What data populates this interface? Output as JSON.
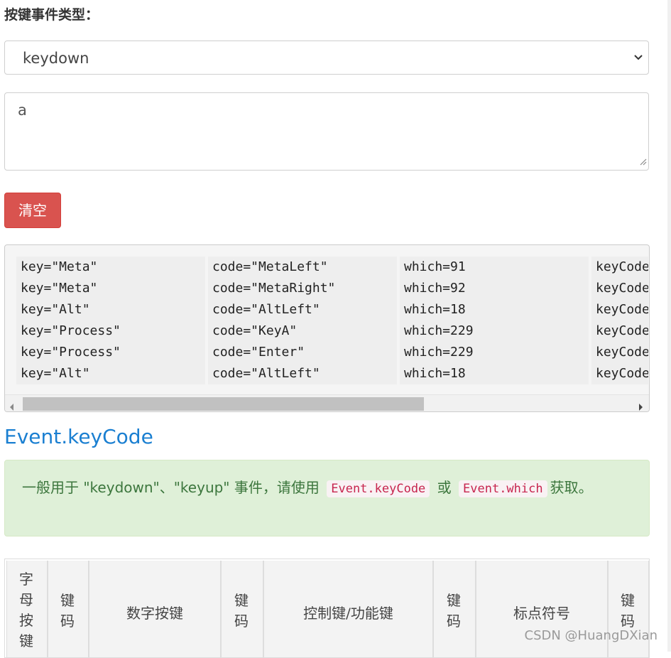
{
  "form": {
    "event_type_label": "按键事件类型：",
    "event_type_value": "keydown",
    "input_value": "a",
    "clear_button": "清空"
  },
  "log": {
    "rows": [
      {
        "key": "key=\"Meta\"",
        "code": "code=\"MetaLeft\"",
        "which": "which=91",
        "keycode": "keyCode"
      },
      {
        "key": "key=\"Meta\"",
        "code": "code=\"MetaRight\"",
        "which": "which=92",
        "keycode": "keyCode"
      },
      {
        "key": "key=\"Alt\"",
        "code": "code=\"AltLeft\"",
        "which": "which=18",
        "keycode": "keyCode"
      },
      {
        "key": "key=\"Process\"",
        "code": "code=\"KeyA\"",
        "which": "which=229",
        "keycode": "keyCode"
      },
      {
        "key": "key=\"Process\"",
        "code": "code=\"Enter\"",
        "which": "which=229",
        "keycode": "keyCode"
      },
      {
        "key": "key=\"Alt\"",
        "code": "code=\"AltLeft\"",
        "which": "which=18",
        "keycode": "keyCode"
      }
    ]
  },
  "section": {
    "title": "Event.keyCode",
    "alert_prefix": "一般用于 \"keydown\"、\"keyup\" 事件，请使用",
    "code1": "Event.keyCode",
    "alert_mid": "或",
    "code2": "Event.which",
    "alert_suffix": "获取。"
  },
  "table": {
    "headers": [
      "字母按键",
      "键码",
      "数字按键",
      "键码",
      "控制键/功能键",
      "键码",
      "标点符号",
      "键码"
    ]
  },
  "watermark": "CSDN @HuangDXian",
  "colors": {
    "danger": "#d9534f",
    "link_blue": "#1a7fd1",
    "success_bg": "#dff0d8",
    "success_text": "#3c763d",
    "code_text": "#c7254e"
  }
}
